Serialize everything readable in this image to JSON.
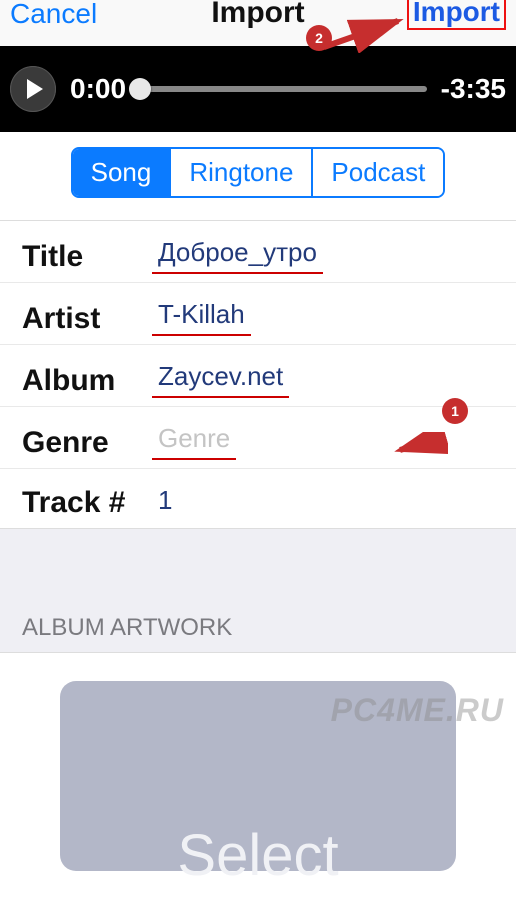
{
  "nav": {
    "cancel": "Cancel",
    "title": "Import",
    "import": "Import"
  },
  "player": {
    "current_time": "0:00",
    "remaining_time": "-3:35"
  },
  "segments": {
    "song": "Song",
    "ringtone": "Ringtone",
    "podcast": "Podcast"
  },
  "fields": {
    "title_label": "Title",
    "title_value": "Доброе_утро",
    "artist_label": "Artist",
    "artist_value": "T-Killah",
    "album_label": "Album",
    "album_value": "Zaycev.net",
    "genre_label": "Genre",
    "genre_placeholder": "Genre",
    "track_label": "Track #",
    "track_value": "1"
  },
  "artwork": {
    "header": "ALBUM ARTWORK",
    "button": "Select"
  },
  "annotations": {
    "badge1": "1",
    "badge2": "2"
  },
  "watermark": "PC4ME.RU"
}
